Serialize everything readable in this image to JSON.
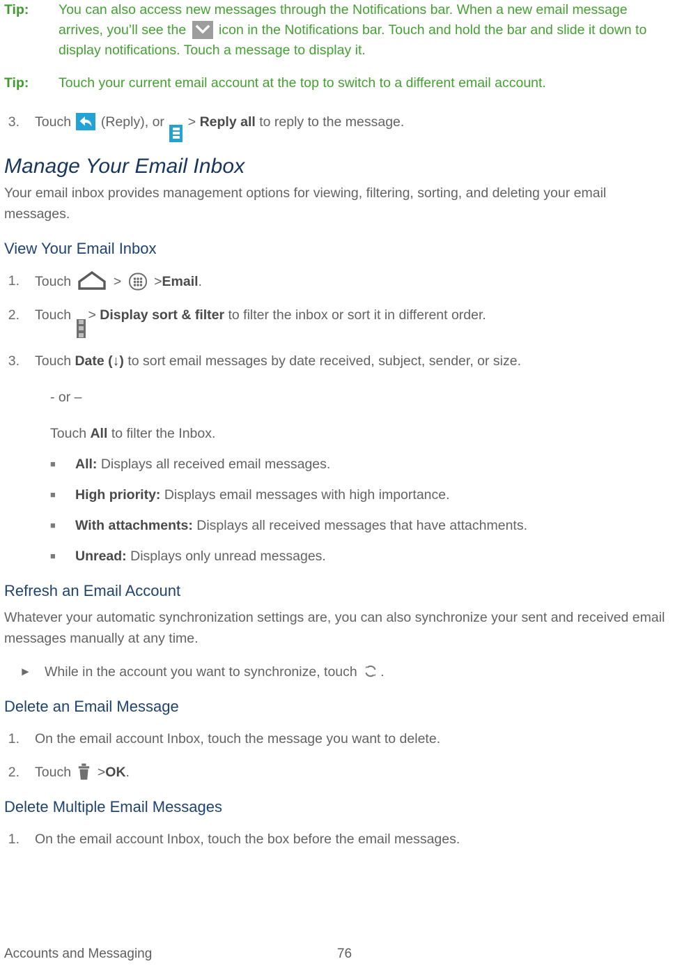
{
  "document": {
    "tips": [
      {
        "label": "Tip:",
        "text_before_icon": "You can also access new messages through the Notifications bar. When a new email message arrives, you’ll see the",
        "icon": "envelope-notification-icon",
        "text_after_icon": "icon in the Notifications bar. Touch and hold the bar and slide it down to display notifications. Touch a message to display it."
      },
      {
        "label": "Tip:",
        "text": "Touch your current email account at the top to switch to a different email account."
      }
    ],
    "reply_step": {
      "number": "3.",
      "touch": "Touch",
      "reply_icon": "reply-icon",
      "reply_paren": "(Reply), or",
      "menu_icon": "overflow-menu-icon",
      "separator": ">",
      "bold_label": "Reply all",
      "tail": "to reply to the message."
    },
    "section_title": "Manage Your Email Inbox",
    "section_intro": "Your email inbox provides management options for viewing, filtering, sorting, and deleting your email messages.",
    "view_inbox": {
      "heading": "View Your Email Inbox",
      "step1": {
        "number": "1.",
        "touch": "Touch",
        "home_icon": "home-icon",
        "sep1": ">",
        "apps_icon": "apps-grid-icon",
        "sep2": ">",
        "bold_label": "Email",
        "period": "."
      },
      "step2": {
        "number": "2.",
        "touch": "Touch",
        "menu_icon": "overflow-menu-icon",
        "separator": ">",
        "bold_label": "Display sort & filter",
        "tail": "to filter the inbox or sort it in different order."
      },
      "step3": {
        "number": "3.",
        "touch": "Touch",
        "bold_label": "Date (↓)",
        "tail": "to sort email messages by date received, subject, sender, or size."
      },
      "or_text": "- or –",
      "alt_text_before": "Touch",
      "alt_bold": "All",
      "alt_text_after": "to filter the Inbox.",
      "filters": [
        {
          "term": "All:",
          "desc": "Displays all received email messages."
        },
        {
          "term": "High priority:",
          "desc": "Displays email messages with high importance."
        },
        {
          "term": "With attachments:",
          "desc": "Displays all received messages that have attachments."
        },
        {
          "term": "Unread:",
          "desc": "Displays only unread messages."
        }
      ]
    },
    "refresh_account": {
      "heading": "Refresh an Email Account",
      "body": "Whatever your automatic synchronization settings are, you can also synchronize your sent and received email messages manually at any time.",
      "step": {
        "marker": "►",
        "text_before_icon": "While in the account you want to synchronize, touch",
        "icon": "refresh-sync-icon",
        "text_after_icon": "."
      }
    },
    "delete_message": {
      "heading": "Delete an Email Message",
      "step1": {
        "number": "1.",
        "text": "On the email account Inbox, touch the message you want to delete."
      },
      "step2": {
        "number": "2.",
        "touch": "Touch",
        "trash_icon": "trash-icon",
        "separator": ">",
        "bold_label": "OK",
        "period": "."
      }
    },
    "delete_multiple": {
      "heading": "Delete Multiple Email Messages",
      "step1": {
        "number": "1.",
        "text": "On the email account Inbox, touch the box before the email messages."
      }
    },
    "footer": {
      "chapter": "Accounts and Messaging",
      "page_number": "76"
    },
    "colors": {
      "tip_green": "#44a032",
      "heading_navy": "#17365d",
      "subheading_blue": "#1f4370",
      "body_gray": "#636363",
      "icon_cyan": "#23a2d4",
      "icon_gray": "#6f6f6f"
    }
  }
}
